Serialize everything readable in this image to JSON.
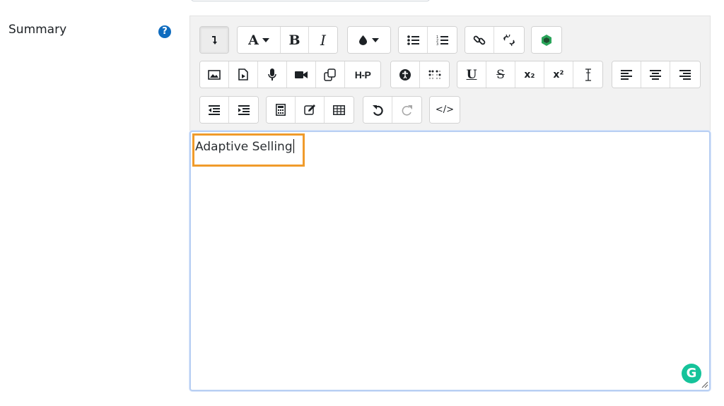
{
  "form": {
    "summary_label": "Summary",
    "help_icon": "?"
  },
  "toolbar": {
    "buttons": {
      "toggle": "toolbar-toggle-icon",
      "font": "A",
      "bold": "B",
      "italic": "I",
      "h5p": "H-P",
      "underline": "U",
      "strike": "S",
      "subscript": "x₂",
      "superscript": "x²",
      "source": "</>"
    }
  },
  "editor": {
    "content": "Adaptive Selling",
    "grammarly": "G"
  },
  "colors": {
    "accent": "#0f6cbf",
    "highlight": "#f09b2b",
    "focus": "#b8cff3",
    "grammarly": "#15c39a"
  }
}
